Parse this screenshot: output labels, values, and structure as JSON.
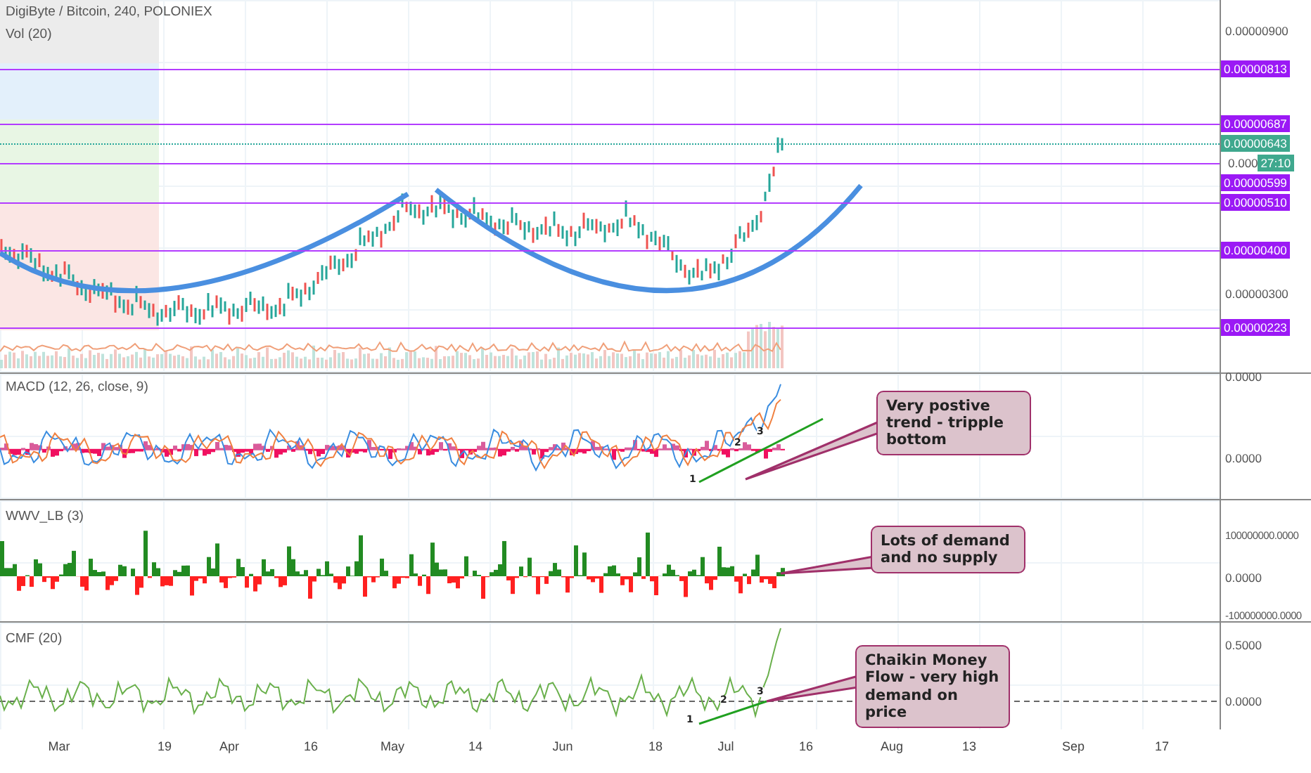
{
  "header": {
    "title": "DigiByte / Bitcoin, 240, POLONIEX",
    "indicator": "Vol (20)"
  },
  "price_axis": {
    "ticks": [
      {
        "label": "0.00000900",
        "kind": "tick"
      },
      {
        "label": "0.00000813",
        "kind": "level"
      },
      {
        "label": "0.00000687",
        "kind": "level"
      },
      {
        "label": "0.00000599",
        "kind": "level"
      },
      {
        "label": "0.00000510",
        "kind": "level"
      },
      {
        "label": "0.00000400",
        "kind": "level"
      },
      {
        "label": "0.00000300",
        "kind": "tick"
      },
      {
        "label": "0.00000223",
        "kind": "level"
      }
    ],
    "last_price": {
      "label": "0.00000643",
      "countdown_prefix": "0.000",
      "countdown": "27:10"
    }
  },
  "panes": [
    {
      "title": "MACD (12, 26, close, 9)",
      "ticks": [
        "0.0000",
        "0.0000"
      ],
      "note": "Very postive trend - tripple bottom",
      "points": [
        "1",
        "2",
        "3"
      ]
    },
    {
      "title": "WWV_LB (3)",
      "ticks": [
        "100000000.0000",
        "0.0000",
        "-100000000.0000"
      ],
      "note": "Lots of demand and no supply"
    },
    {
      "title": "CMF (20)",
      "ticks": [
        "0.5000",
        "0.0000"
      ],
      "note": "Chaikin Money Flow - very high demand on price",
      "points": [
        "1",
        "2",
        "3"
      ]
    }
  ],
  "time_axis": [
    "Mar",
    "19",
    "Apr",
    "16",
    "May",
    "14",
    "Jun",
    "18",
    "Jul",
    "16",
    "Aug",
    "13",
    "Sep",
    "17"
  ]
}
